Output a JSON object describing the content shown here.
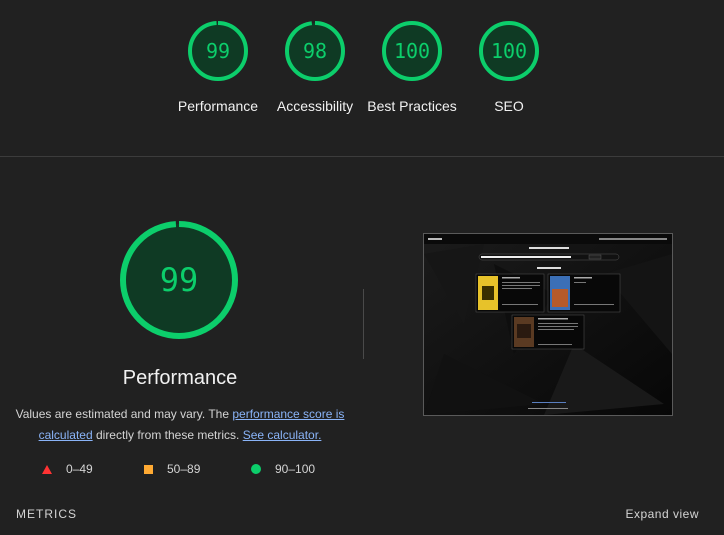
{
  "categories": [
    {
      "id": "performance",
      "score": "99",
      "label": "Performance",
      "fill": 0.99
    },
    {
      "id": "accessibility",
      "score": "98",
      "label": "Accessibility",
      "fill": 0.98
    },
    {
      "id": "best-practices",
      "score": "100",
      "label": "Best Practices",
      "fill": 1.0
    },
    {
      "id": "seo",
      "score": "100",
      "label": "SEO",
      "fill": 1.0
    }
  ],
  "main_gauge": {
    "score": "99",
    "label": "Performance",
    "fill": 0.99
  },
  "description": {
    "before": "Values are estimated and may vary. The ",
    "link1": "performance score is calculated",
    "middle": " directly from these metrics. ",
    "link2": "See calculator."
  },
  "legend": [
    {
      "shape": "triangle",
      "range": "0–49",
      "color": "#ff3333"
    },
    {
      "shape": "square",
      "range": "50–89",
      "color": "#ffaa33"
    },
    {
      "shape": "circle",
      "range": "90–100",
      "color": "#0cce6b"
    }
  ],
  "metrics_label": "METRICS",
  "expand_view": "Expand view",
  "colors": {
    "pass": "#0cce6b",
    "background": "#212121"
  }
}
